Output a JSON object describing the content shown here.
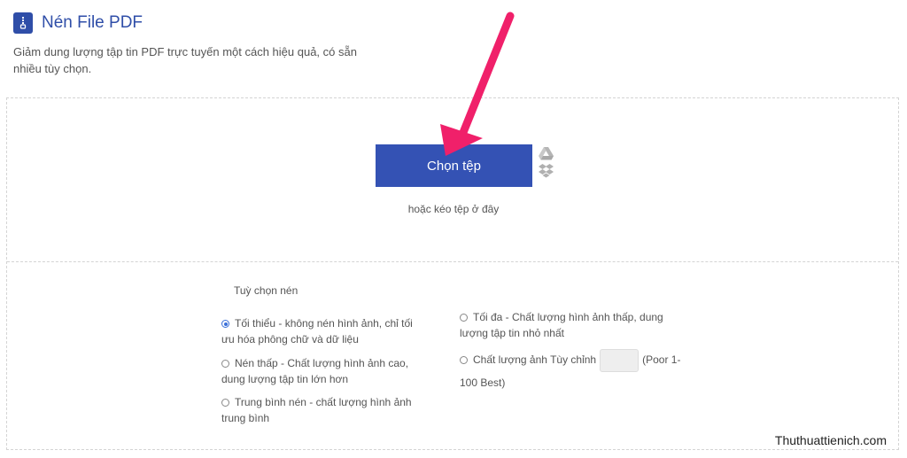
{
  "header": {
    "title": "Nén File PDF",
    "subtitle": "Giảm dung lượng tập tin PDF trực tuyến một cách hiệu quả, có sẵn nhiều tùy chọn."
  },
  "upload": {
    "button_label": "Chọn tệp",
    "drop_text": "hoặc kéo tệp ở đây",
    "icons": [
      "google-drive-icon",
      "dropbox-icon"
    ]
  },
  "options": {
    "label": "Tuỳ chọn nén",
    "left": [
      {
        "text": "Tối thiểu - không nén hình ảnh, chỉ tối ưu hóa phông chữ và dữ liệu",
        "checked": true
      },
      {
        "text": "Nén thấp - Chất lượng hình ảnh cao, dung lượng tập tin lớn hơn",
        "checked": false
      },
      {
        "text": "Trung bình nén - chất lượng hình ảnh trung bình",
        "checked": false
      }
    ],
    "right": [
      {
        "text": "Tối đa - Chất lượng hình ảnh thấp, dung lượng tập tin nhỏ nhất",
        "checked": false
      },
      {
        "text_before": "Chất lượng ảnh Tùy chỉnh",
        "text_after": "(Poor 1-100 Best)",
        "input_value": "",
        "checked": false
      }
    ]
  },
  "watermark": "Thuthuattienich.com",
  "colors": {
    "accent": "#3452b4",
    "arrow": "#f0206a"
  }
}
